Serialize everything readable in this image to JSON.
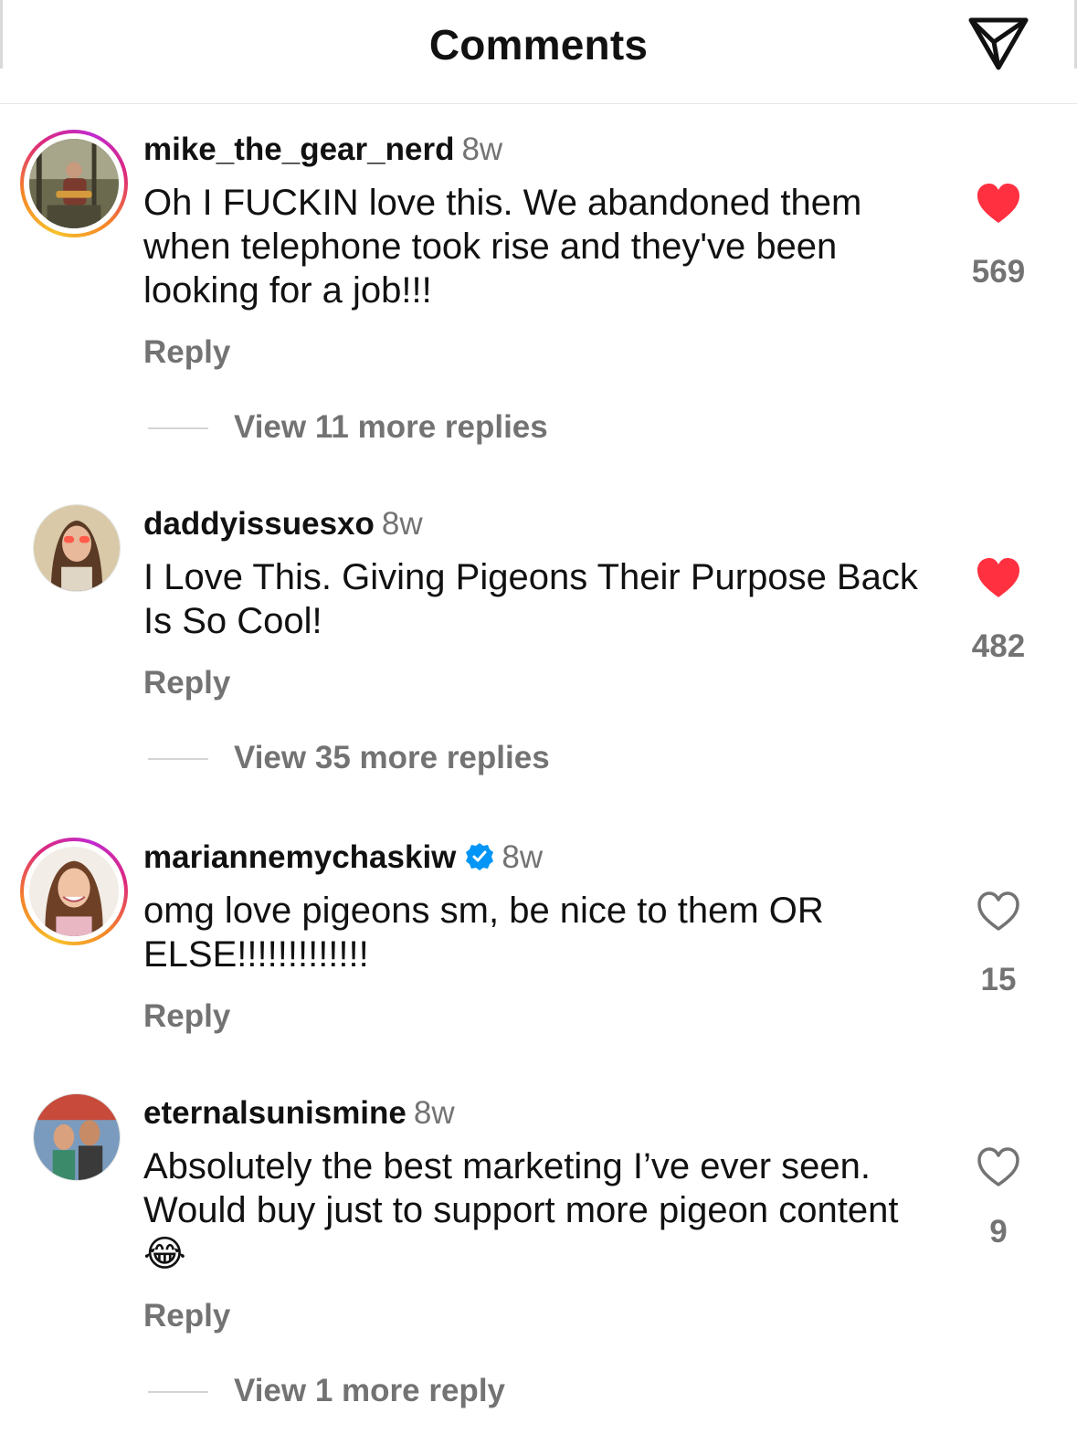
{
  "header": {
    "title": "Comments",
    "share_icon": "send-paper-plane-icon"
  },
  "colors": {
    "like_red": "#ff3040",
    "verified_blue": "#0095f6",
    "muted_text": "#737373"
  },
  "comments": [
    {
      "username": "mike_the_gear_nerd",
      "time": "8w",
      "verified": false,
      "text": "Oh I FUCKIN love this. We abandoned them when telephone took rise and they've been looking for a job!!!",
      "reply_label": "Reply",
      "view_replies": "View 11 more replies",
      "likes": "569",
      "liked": true
    },
    {
      "username": "daddyissuesxo",
      "time": "8w",
      "verified": false,
      "text": "I Love This. Giving Pigeons Their Purpose Back Is So Cool!",
      "reply_label": "Reply",
      "view_replies": "View 35 more replies",
      "likes": "482",
      "liked": true
    },
    {
      "username": "mariannemychaskiw",
      "time": "8w",
      "verified": true,
      "text": "omg love pigeons sm, be nice to them OR ELSE!!!!!!!!!!!!!",
      "reply_label": "Reply",
      "likes": "15",
      "liked": false
    },
    {
      "username": "eternalsunismine",
      "time": "8w",
      "verified": false,
      "text": "Absolutely the best marketing I’ve ever seen. Would buy just to support more pigeon content",
      "emoji": "😂",
      "reply_label": "Reply",
      "view_replies": "View 1 more reply",
      "likes": "9",
      "liked": false
    }
  ]
}
